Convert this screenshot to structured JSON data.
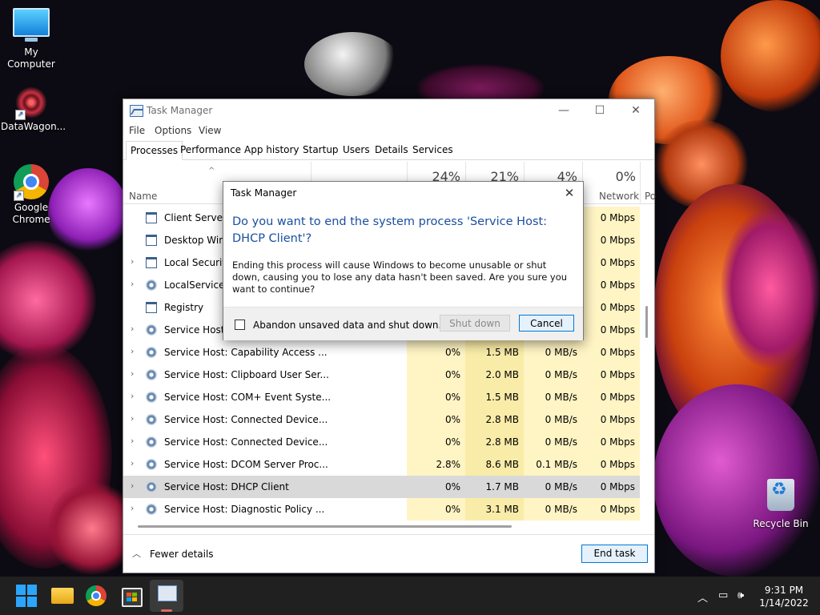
{
  "desktop": {
    "icons": [
      {
        "label": "My Computer"
      },
      {
        "label": "DataWagon..."
      },
      {
        "label": "Google Chrome"
      },
      {
        "label": "Recycle Bin"
      }
    ]
  },
  "task_manager": {
    "title": "Task Manager",
    "menu": [
      "File",
      "Options",
      "View"
    ],
    "tabs": [
      "Processes",
      "Performance",
      "App history",
      "Startup",
      "Users",
      "Details",
      "Services"
    ],
    "active_tab": "Processes",
    "header": {
      "name_label": "Name",
      "cpu_pct": "24%",
      "mem_pct": "21%",
      "disk_pct": "4%",
      "net_pct": "0%",
      "net_label": "Network",
      "power_label": "Po"
    },
    "processes": [
      {
        "name": "Client Server R",
        "expandable": false,
        "icon": "window-icon",
        "net": "0 Mbps"
      },
      {
        "name": "Desktop Windo",
        "expandable": false,
        "icon": "window-icon",
        "net": "0 Mbps"
      },
      {
        "name": "Local Security",
        "expandable": true,
        "icon": "window-icon",
        "net": "0 Mbps"
      },
      {
        "name": "LocalServiceN",
        "expandable": true,
        "icon": "gear-icon",
        "net": "0 Mbps"
      },
      {
        "name": "Registry",
        "expandable": false,
        "icon": "window-icon",
        "net": "0 Mbps"
      },
      {
        "name": "Service Host: A",
        "expandable": true,
        "icon": "gear-icon",
        "net": "0 Mbps"
      },
      {
        "name": "Service Host: Capability Access ...",
        "expandable": true,
        "icon": "gear-icon",
        "cpu": "0%",
        "mem": "1.5 MB",
        "disk": "0 MB/s",
        "net": "0 Mbps"
      },
      {
        "name": "Service Host: Clipboard User Ser...",
        "expandable": true,
        "icon": "gear-icon",
        "cpu": "0%",
        "mem": "2.0 MB",
        "disk": "0 MB/s",
        "net": "0 Mbps"
      },
      {
        "name": "Service Host: COM+ Event Syste...",
        "expandable": true,
        "icon": "gear-icon",
        "cpu": "0%",
        "mem": "1.5 MB",
        "disk": "0 MB/s",
        "net": "0 Mbps"
      },
      {
        "name": "Service Host: Connected Device...",
        "expandable": true,
        "icon": "gear-icon",
        "cpu": "0%",
        "mem": "2.8 MB",
        "disk": "0 MB/s",
        "net": "0 Mbps"
      },
      {
        "name": "Service Host: Connected Device...",
        "expandable": true,
        "icon": "gear-icon",
        "cpu": "0%",
        "mem": "2.8 MB",
        "disk": "0 MB/s",
        "net": "0 Mbps"
      },
      {
        "name": "Service Host: DCOM Server Proc...",
        "expandable": true,
        "icon": "gear-icon",
        "cpu": "2.8%",
        "mem": "8.6 MB",
        "disk": "0.1 MB/s",
        "net": "0 Mbps"
      },
      {
        "name": "Service Host: DHCP Client",
        "expandable": true,
        "icon": "gear-icon",
        "cpu": "0%",
        "mem": "1.7 MB",
        "disk": "0 MB/s",
        "net": "0 Mbps",
        "selected": true
      },
      {
        "name": "Service Host: Diagnostic Policy ...",
        "expandable": true,
        "icon": "gear-icon",
        "cpu": "0%",
        "mem": "3.1 MB",
        "disk": "0 MB/s",
        "net": "0 Mbps"
      }
    ],
    "footer": {
      "fewer_details": "Fewer details",
      "end_task": "End task"
    }
  },
  "dialog": {
    "title": "Task Manager",
    "heading": "Do you want to end the system process 'Service Host: DHCP Client'?",
    "body": "Ending this process will cause Windows to become unusable or shut down, causing you to lose any data hasn't been saved. Are you sure you want to continue?",
    "checkbox_label": "Abandon unsaved data and shut down.",
    "checkbox_checked": false,
    "shutdown_label": "Shut down",
    "cancel_label": "Cancel"
  },
  "taskbar": {
    "time": "9:31 PM",
    "date": "1/14/2022"
  },
  "colors": {
    "accent": "#0078d4",
    "heading_blue": "#1a4fa0",
    "cpu_heat": "#fff4c4",
    "mem_heat": "#f9eca8",
    "taskbar": "#202020"
  }
}
